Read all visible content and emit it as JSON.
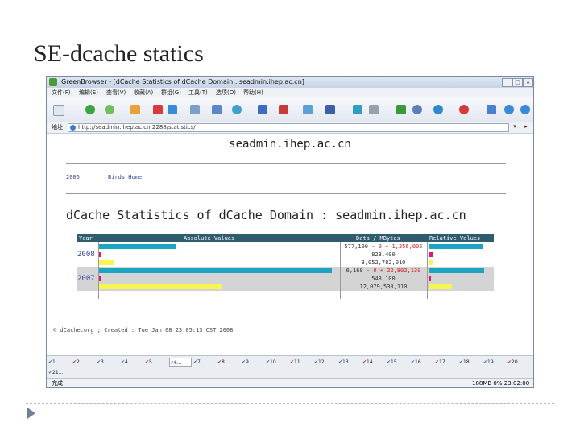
{
  "slide": {
    "title": "SE-dcache statics"
  },
  "window": {
    "title": "GreenBrowser - [dCache Statistics of dCache Domain : seadmin.ihep.ac.cn]",
    "menu": [
      "文件(F)",
      "编辑(E)",
      "查看(V)",
      "收藏(A)",
      "群组(G)",
      "工具(T)",
      "选项(O)",
      "帮助(H)"
    ],
    "address_label": "地址",
    "url": "http://seadmin.ihep.ac.cn:2288/statistics/",
    "status_left": "完成",
    "status_right": "188MB 0% 23:02:00"
  },
  "page": {
    "host": "seadmin.ihep.ac.cn",
    "links": [
      "2006",
      "Birds Home"
    ],
    "heading": "dCache Statistics of dCache Domain : seadmin.ihep.ac.cn",
    "table": {
      "headers": [
        "Year",
        "Absolute Values",
        "Data / MBytes",
        "Relative Values"
      ],
      "rows": [
        {
          "year": "",
          "data_a": "577,100 - ",
          "data_b": "0 + 1,256,005",
          "abs": 0.33,
          "rel": 0.84,
          "abs_color": "#1ba5c0",
          "rel_color": "#1ba5c0",
          "alt": false
        },
        {
          "year": "2008",
          "data_a": "823,400",
          "data_b": "",
          "abs": 0.01,
          "rel": 0.07,
          "abs_color": "#e2186f",
          "rel_color": "#e2186f",
          "alt": false
        },
        {
          "year": "",
          "data_a": "3,052,782,010",
          "data_b": "",
          "abs": 0.07,
          "rel": 0.06,
          "abs_color": "#f6f650",
          "rel_color": "#f6f650",
          "alt": false
        },
        {
          "year": "",
          "data_a": "6,168 - ",
          "data_b": "0 + 22,802,130",
          "abs": 1.0,
          "rel": 0.87,
          "abs_color": "#1ba5c0",
          "rel_color": "#1ba5c0",
          "alt": true
        },
        {
          "year": "2007",
          "data_a": "543,100",
          "data_b": "",
          "abs": 0.01,
          "rel": 0.02,
          "abs_color": "#e2186f",
          "rel_color": "#e2186f",
          "alt": true
        },
        {
          "year": "",
          "data_a": "12,079,530,110",
          "data_b": "",
          "abs": 0.53,
          "rel": 0.36,
          "abs_color": "#f6f650",
          "rel_color": "#f6f650",
          "alt": true
        }
      ]
    },
    "footnote": "© dCache.org ; Created : Tue Jan 08 23:05:13 CST 2008"
  },
  "tabs": {
    "row1": [
      "1...",
      "2...",
      "3...",
      "4...",
      "5...",
      "6...",
      "7...",
      "8...",
      "9...",
      "10...",
      "11...",
      "12...",
      "13...",
      "14...",
      "15...",
      "16...",
      "17...",
      "18...",
      "19...",
      "20..."
    ],
    "row2": [
      "21..."
    ]
  }
}
